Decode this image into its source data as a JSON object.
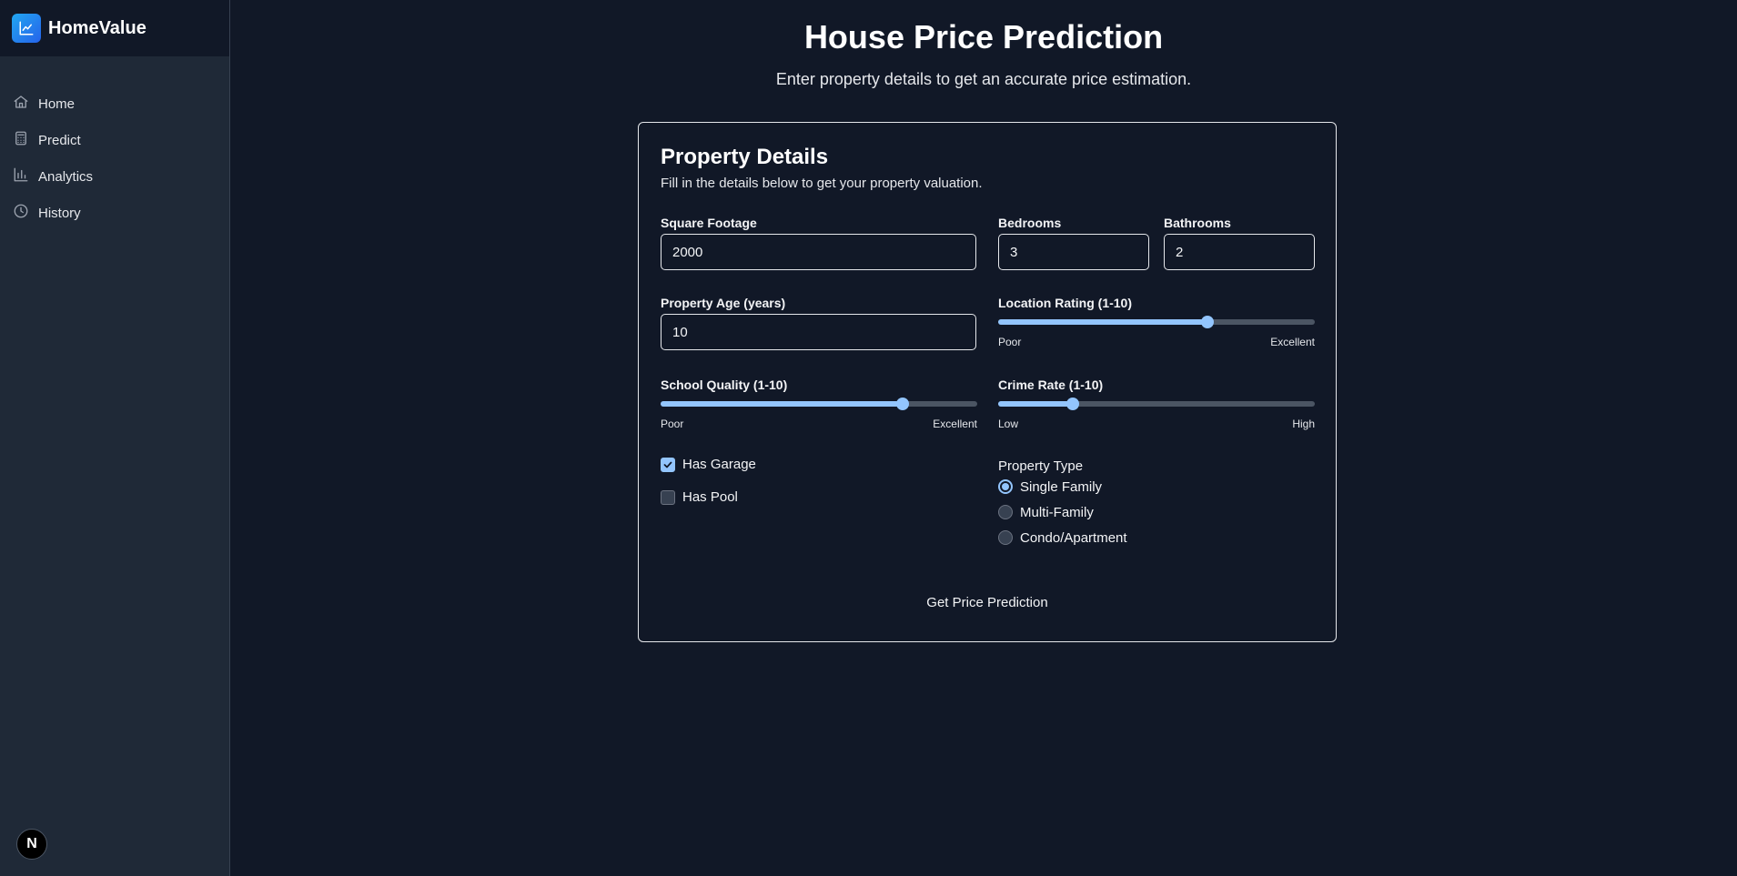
{
  "brand": {
    "name": "HomeValue",
    "icon": "trending-chart-icon"
  },
  "nav": [
    {
      "label": "Home",
      "icon": "home-icon"
    },
    {
      "label": "Predict",
      "icon": "calculator-icon"
    },
    {
      "label": "Analytics",
      "icon": "bar-chart-icon"
    },
    {
      "label": "History",
      "icon": "clock-icon"
    }
  ],
  "footer_badge": "N",
  "header": {
    "title": "House Price Prediction",
    "subtitle": "Enter property details to get an accurate price estimation."
  },
  "form": {
    "title": "Property Details",
    "description": "Fill in the details below to get your property valuation.",
    "square_footage": {
      "label": "Square Footage",
      "value": "2000"
    },
    "bedrooms": {
      "label": "Bedrooms",
      "value": "3"
    },
    "bathrooms": {
      "label": "Bathrooms",
      "value": "2"
    },
    "property_age": {
      "label": "Property Age (years)",
      "value": "10"
    },
    "location_rating": {
      "label": "Location Rating (1-10)",
      "fraction": 0.66,
      "min_label": "Poor",
      "max_label": "Excellent"
    },
    "school_quality": {
      "label": "School Quality (1-10)",
      "fraction": 0.765,
      "min_label": "Poor",
      "max_label": "Excellent"
    },
    "crime_rate": {
      "label": "Crime Rate (1-10)",
      "fraction": 0.235,
      "min_label": "Low",
      "max_label": "High"
    },
    "has_garage": {
      "label": "Has Garage",
      "checked": true
    },
    "has_pool": {
      "label": "Has Pool",
      "checked": false
    },
    "property_type": {
      "label": "Property Type",
      "options": [
        "Single Family",
        "Multi-Family",
        "Condo/Apartment"
      ],
      "selected": "Single Family"
    },
    "submit_label": "Get Price Prediction"
  },
  "colors": {
    "accent": "#93c5fd",
    "background": "#111827",
    "sidebar": "#1f2937"
  }
}
